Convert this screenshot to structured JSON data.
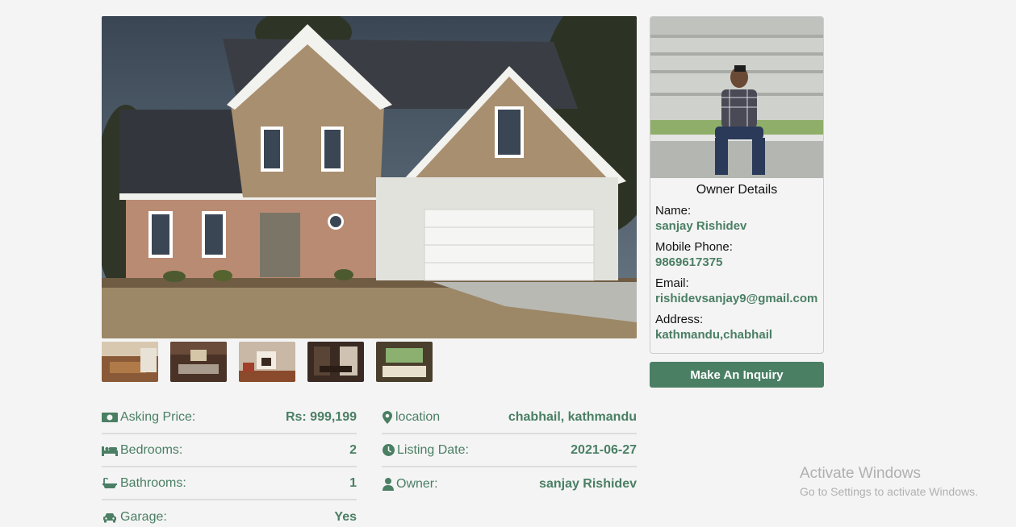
{
  "listing": {
    "main_photo_alt": "house",
    "thumbnails": [
      "kitchen",
      "living room",
      "fireplace room",
      "dining room",
      "bedroom"
    ]
  },
  "owner": {
    "title": "Owner Details",
    "name_label": "Name:",
    "name": "sanjay Rishidev",
    "phone_label": "Mobile Phone:",
    "phone": "9869617375",
    "email_label": "Email:",
    "email": "rishidevsanjay9@gmail.com",
    "address_label": "Address:",
    "address": "kathmandu,chabhail",
    "inquiry_button": "Make An Inquiry"
  },
  "details_left": [
    {
      "icon": "money-icon",
      "label": "Asking Price:",
      "value": "Rs: 999,199"
    },
    {
      "icon": "bed-icon",
      "label": "Bedrooms:",
      "value": "2"
    },
    {
      "icon": "bath-icon",
      "label": "Bathrooms:",
      "value": "1"
    },
    {
      "icon": "car-icon",
      "label": "Garage:",
      "value": "Yes"
    }
  ],
  "details_right": [
    {
      "icon": "map-marker-icon",
      "label": "location",
      "value": "chabhail, kathmandu"
    },
    {
      "icon": "clock-icon",
      "label": "Listing Date:",
      "value": "2021-06-27"
    },
    {
      "icon": "user-icon",
      "label": "Owner:",
      "value": "sanjay Rishidev"
    }
  ],
  "watermark": {
    "title": "Activate Windows",
    "subtitle": "Go to Settings to activate Windows."
  },
  "colors": {
    "accent": "#4a7f64",
    "background": "#f4f4f4"
  }
}
